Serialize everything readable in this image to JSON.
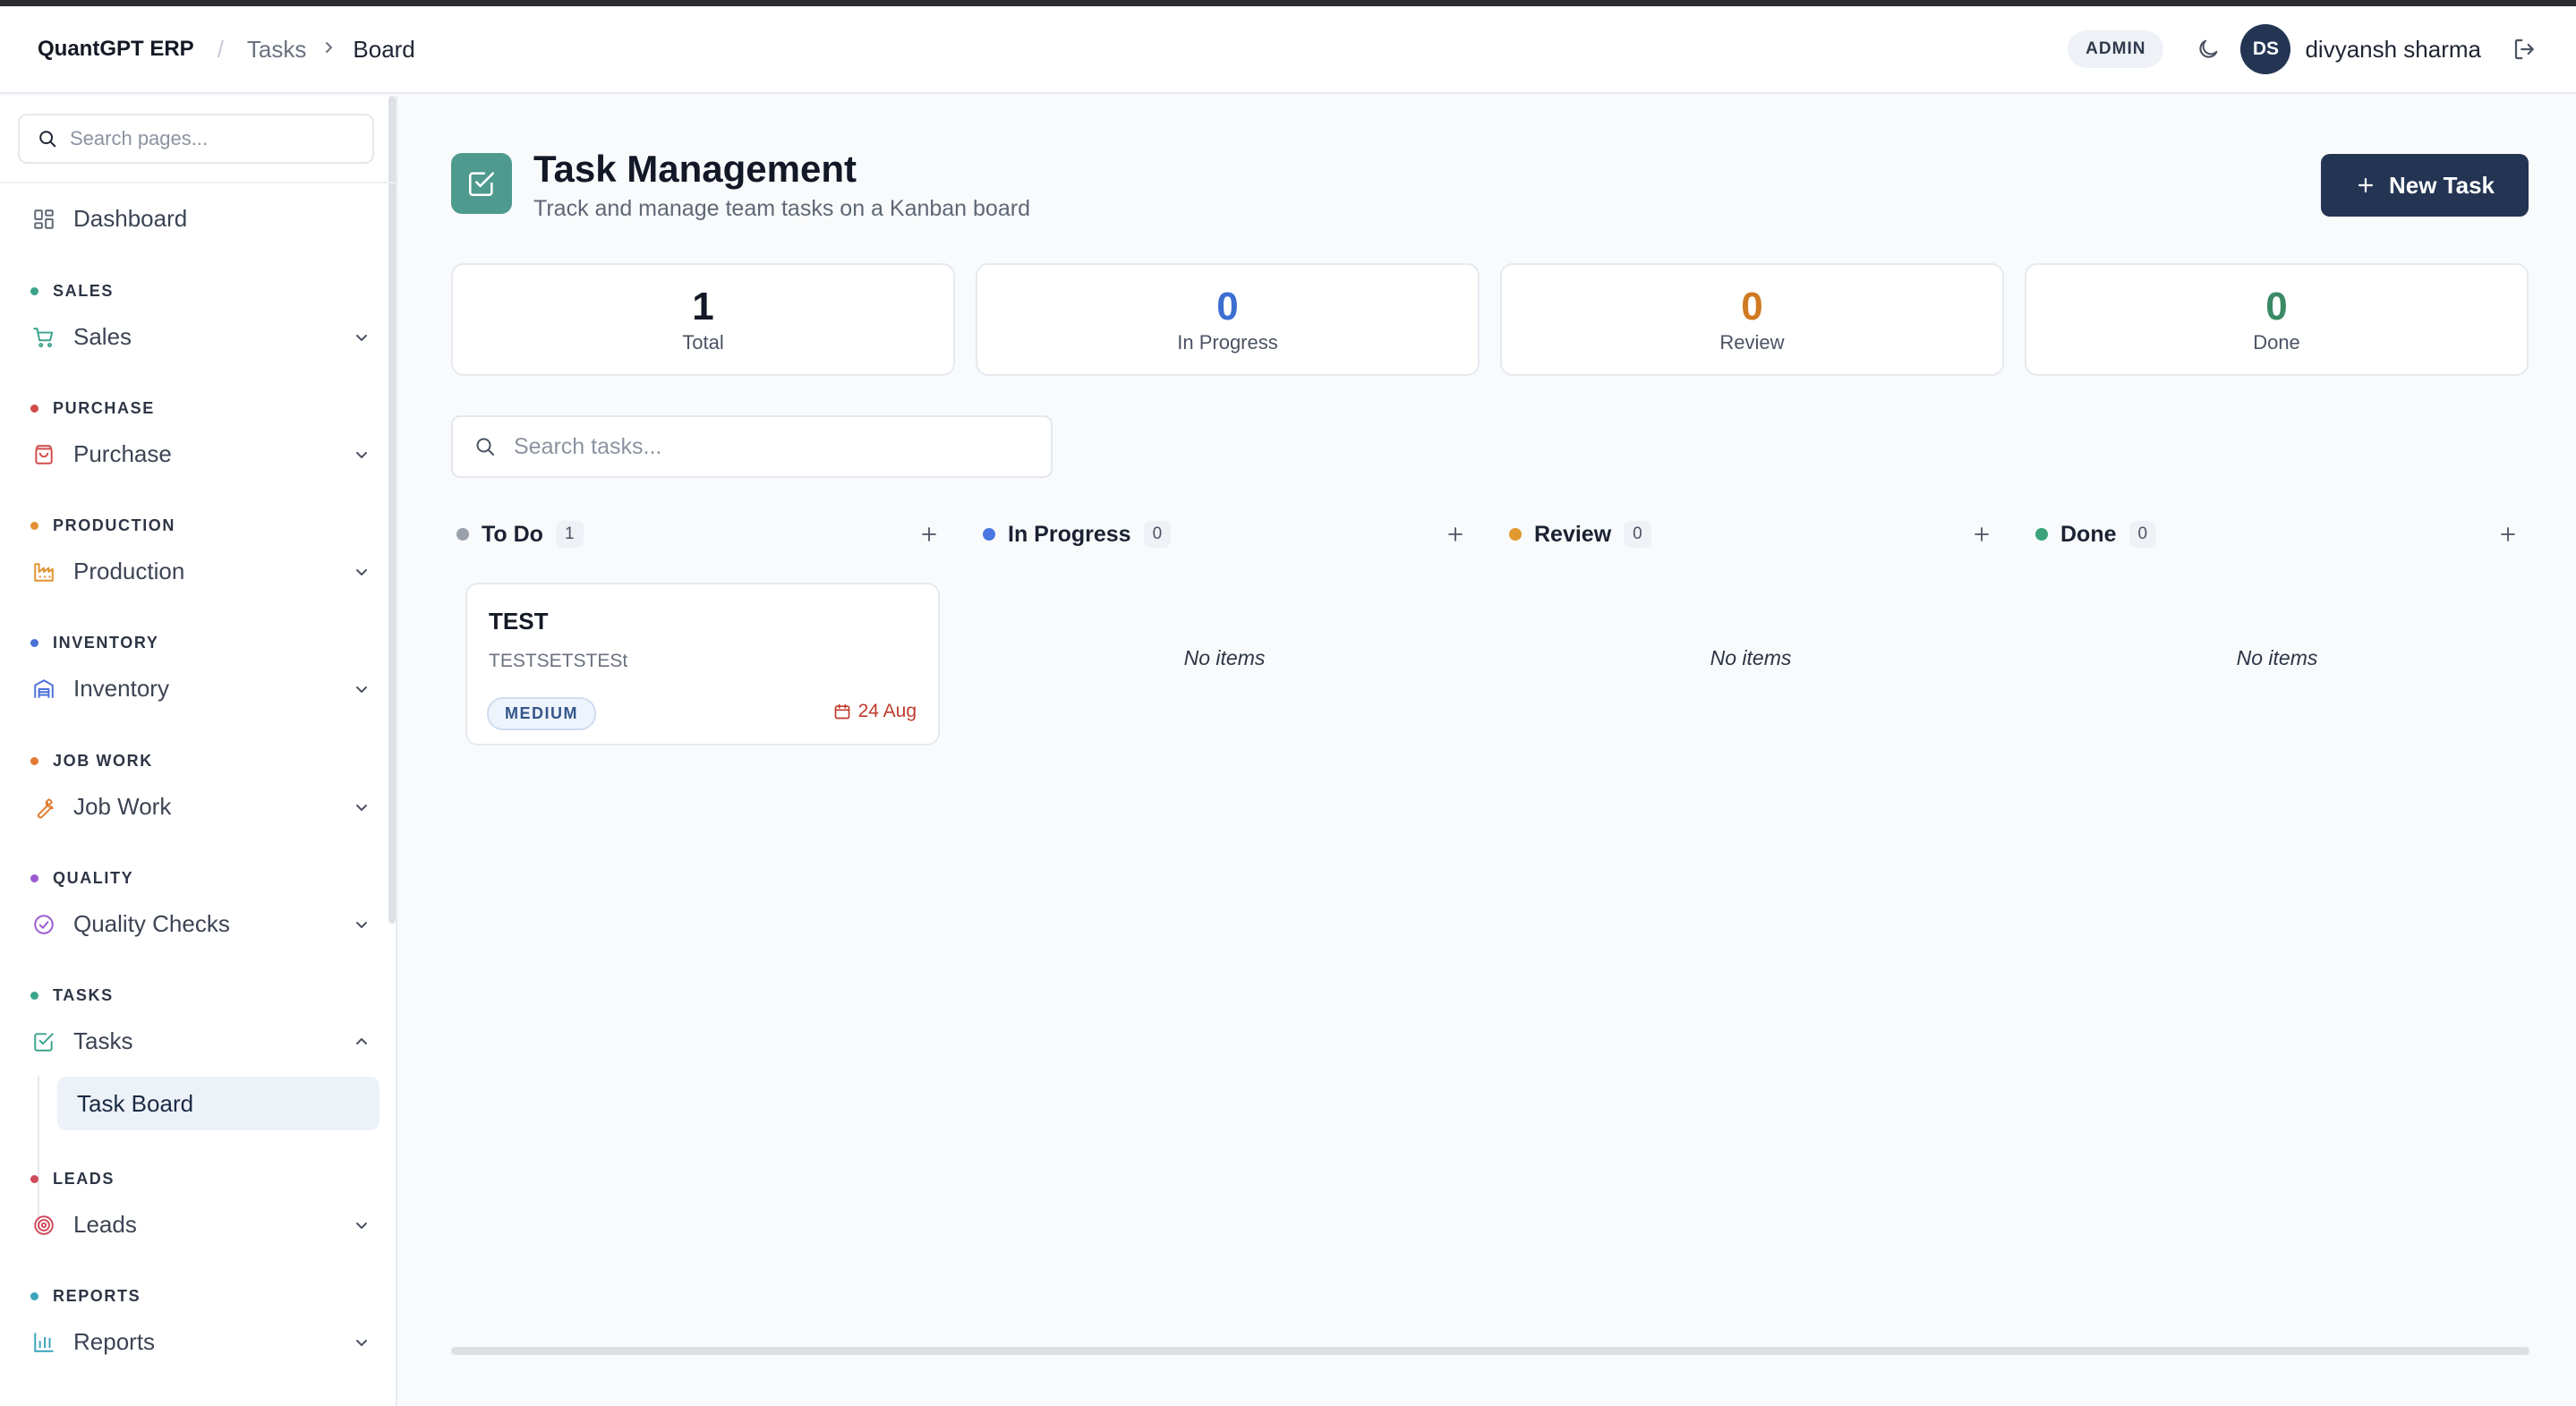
{
  "header": {
    "brand": "QuantGPT ERP",
    "breadcrumb_sep": "/",
    "breadcrumb_parent": "Tasks",
    "breadcrumb_current": "Board",
    "role_badge": "ADMIN",
    "avatar_initials": "DS",
    "username": "divyansh sharma"
  },
  "sidebar": {
    "search_placeholder": "Search pages...",
    "dashboard": "Dashboard",
    "sections": [
      {
        "title": "SALES",
        "item": "Sales",
        "color": "#3aa38b"
      },
      {
        "title": "PURCHASE",
        "item": "Purchase",
        "color": "#d04a4a"
      },
      {
        "title": "PRODUCTION",
        "item": "Production",
        "color": "#e0902f"
      },
      {
        "title": "INVENTORY",
        "item": "Inventory",
        "color": "#4a6fd6"
      },
      {
        "title": "JOB WORK",
        "item": "Job Work",
        "color": "#e07a2f"
      },
      {
        "title": "QUALITY",
        "item": "Quality Checks",
        "color": "#9b59d0"
      },
      {
        "title": "TASKS",
        "item": "Tasks",
        "color": "#3aa38b"
      },
      {
        "title": "LEADS",
        "item": "Leads",
        "color": "#d04a5a"
      },
      {
        "title": "REPORTS",
        "item": "Reports",
        "color": "#3aa3b8"
      }
    ],
    "active_sub_item": "Task Board"
  },
  "main": {
    "title": "Task Management",
    "subtitle": "Track and manage team tasks on a Kanban board",
    "new_task_label": "New Task",
    "stats": [
      {
        "value": "1",
        "label": "Total",
        "color": "#121826"
      },
      {
        "value": "0",
        "label": "In Progress",
        "color": "#3b6fd0"
      },
      {
        "value": "0",
        "label": "Review",
        "color": "#d07a22"
      },
      {
        "value": "0",
        "label": "Done",
        "color": "#3b8a66"
      }
    ],
    "search_placeholder": "Search tasks...",
    "columns": [
      {
        "name": "To Do",
        "count": "1",
        "color": "#9aa1ad"
      },
      {
        "name": "In Progress",
        "count": "0",
        "color": "#4a78e0"
      },
      {
        "name": "Review",
        "count": "0",
        "color": "#e09a2f"
      },
      {
        "name": "Done",
        "count": "0",
        "color": "#3aa37b"
      }
    ],
    "empty_text": "No items",
    "card": {
      "title": "TEST",
      "description": "TESTSETSTESt",
      "priority": "MEDIUM",
      "due": "24 Aug"
    }
  }
}
